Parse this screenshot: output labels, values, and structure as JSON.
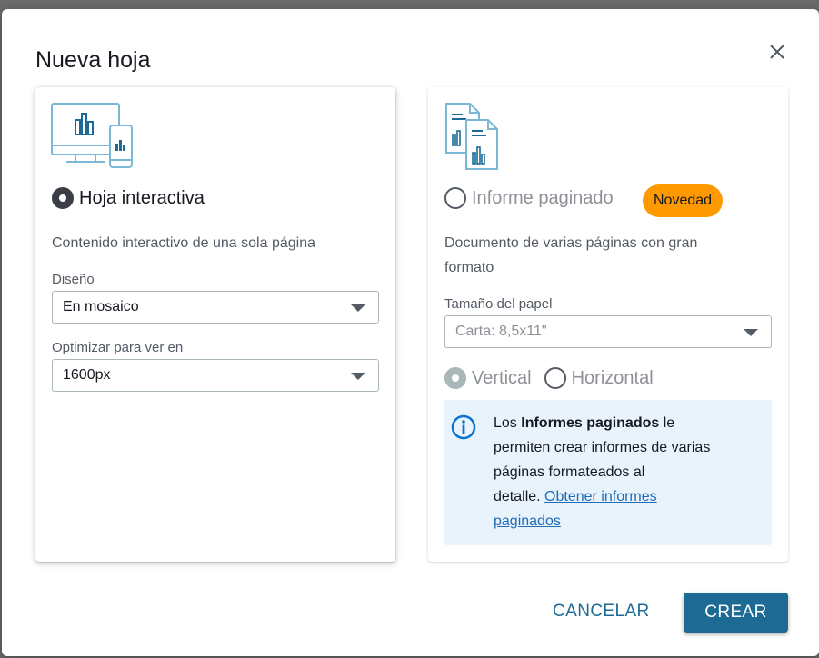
{
  "dialog": {
    "title": "Nueva hoja",
    "close_icon": "close-icon"
  },
  "interactive": {
    "icon": "monitor-and-phone-chart-icon",
    "option_label": "Hoja interactiva",
    "selected": true,
    "description": "Contenido interactivo de una sola página",
    "layout_label": "Diseño",
    "layout_value": "En mosaico",
    "optimize_label": "Optimizar para ver en",
    "optimize_value": "1600px"
  },
  "paginated": {
    "icon": "paginated-documents-icon",
    "option_label": "Informe paginado",
    "selected": false,
    "badge": "Novedad",
    "description_line1": "Documento de varias páginas con gran",
    "description_line2": "formato",
    "paper_label": "Tamaño del papel",
    "paper_value": "Carta: 8,5x11\"",
    "orientation_vertical": "Vertical",
    "orientation_horizontal": "Horizontal",
    "info": {
      "icon": "info-icon",
      "prefix": "Los ",
      "bold": "Informes paginados",
      "line1_suffix": " le",
      "line2": "permiten crear informes de varias",
      "line3": "páginas formateados al",
      "line4_prefix": "detalle. ",
      "link_line1": "Obtener informes",
      "link_line2": "paginados"
    }
  },
  "footer": {
    "cancel_label": "CANCELAR",
    "create_label": "CREAR"
  },
  "colors": {
    "primary": "#1d6a94",
    "badge": "#ff9900",
    "info_bg": "#e8f3fc"
  }
}
